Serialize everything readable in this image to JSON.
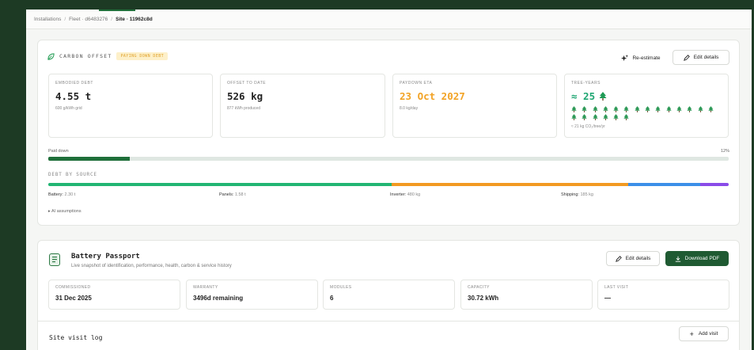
{
  "breadcrumb": {
    "items": [
      "Installations",
      "Fleet · d6483276",
      "Site · 11962c8d"
    ]
  },
  "carbon": {
    "title": "CARBON OFFSET",
    "badge": "PAYING DOWN DEBT",
    "reestimate_label": "Re-estimate",
    "edit_label": "Edit details",
    "stats": [
      {
        "label": "EMBODIED DEBT",
        "value": "4.55 t",
        "sub": "600 g/kWh grid"
      },
      {
        "label": "OFFSET TO DATE",
        "value": "526 kg",
        "sub": "877 kWh produced"
      },
      {
        "label": "PAYDOWN ETA",
        "value": "23 Oct 2027",
        "sub": "8.0 kg/day"
      },
      {
        "label": "TREE-YEARS",
        "value": "≈ 25",
        "sub": "≈ 21 kg CO₂/tree/yr"
      }
    ],
    "tree_count": 20,
    "paid_label": "Paid down",
    "paid_percent_label": "12%",
    "paid_fraction": 0.12,
    "debt_title": "DEBT BY SOURCE",
    "sources": [
      {
        "name": "Battery",
        "value": "2.30 t",
        "share": 0.505,
        "color": "#21b573"
      },
      {
        "name": "Panels",
        "value": "1.58 t",
        "share": 0.347,
        "color": "#f29a21"
      },
      {
        "name": "Inverter",
        "value": "480 kg",
        "share": 0.106,
        "color": "#3b8fe8"
      },
      {
        "name": "Shipping",
        "value": "185 kg",
        "share": 0.042,
        "color": "#8a4be8"
      }
    ],
    "ai_label": "▸ AI assumptions"
  },
  "colors": {
    "accent_green": "#1f5a32",
    "paid_bar": "#1f6f3a",
    "eta_orange": "#f2a325",
    "tree_teal": "#1ea672"
  },
  "passport": {
    "title": "Battery Passport",
    "subtitle": "Live snapshot of identification, performance, health, carbon & service history",
    "edit_label": "Edit details",
    "download_label": "Download PDF",
    "fields": [
      {
        "label": "COMMISSIONED",
        "value": "31 Dec 2025"
      },
      {
        "label": "WARRANTY",
        "value": "3496d remaining"
      },
      {
        "label": "MODULES",
        "value": "6"
      },
      {
        "label": "CAPACITY",
        "value": "30.72 kWh"
      },
      {
        "label": "LAST VISIT",
        "value": "—"
      }
    ],
    "visit_log_title": "Site visit log",
    "add_visit_label": "Add visit"
  }
}
